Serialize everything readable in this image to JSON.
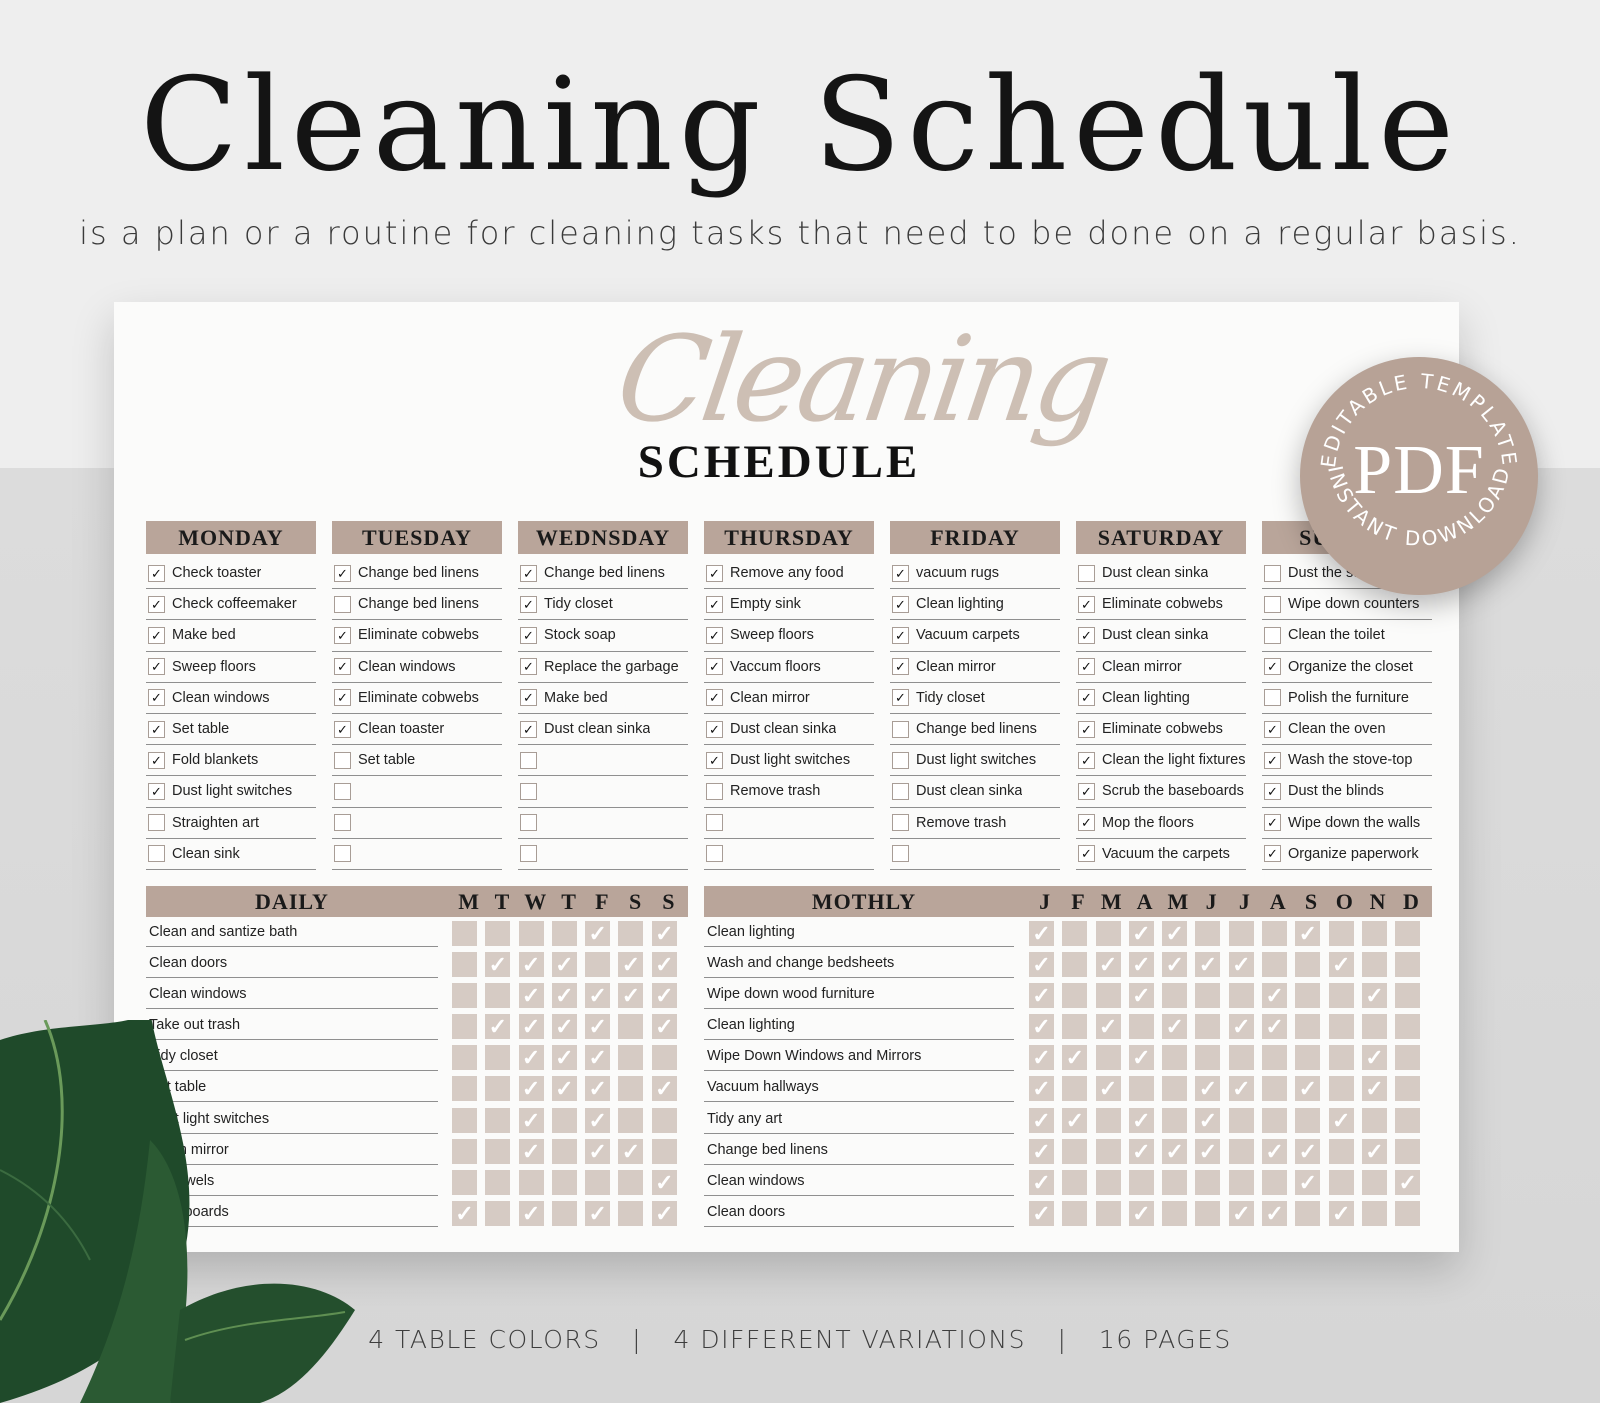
{
  "hero": {
    "title": "Cleaning Schedule",
    "subtitle": "is a plan or a routine for cleaning tasks that need to be done on a regular basis."
  },
  "sheet": {
    "script_title": "Cleaning",
    "title": "SCHEDULE",
    "accent_color": "#b9a59a",
    "cell_color": "#d6cbc4"
  },
  "weekdays": [
    {
      "name": "MONDAY",
      "tasks": [
        {
          "label": "Check toaster",
          "done": true
        },
        {
          "label": "Check coffeemaker",
          "done": true
        },
        {
          "label": "Make bed",
          "done": true
        },
        {
          "label": "Sweep floors",
          "done": true
        },
        {
          "label": "Clean windows",
          "done": true
        },
        {
          "label": "Set table",
          "done": true
        },
        {
          "label": "Fold blankets",
          "done": true
        },
        {
          "label": "Dust light switches",
          "done": true
        },
        {
          "label": "Straighten art",
          "done": false
        },
        {
          "label": "Clean sink",
          "done": false
        }
      ]
    },
    {
      "name": "TUESDAY",
      "tasks": [
        {
          "label": "Change bed linens",
          "done": true
        },
        {
          "label": "Change bed linens",
          "done": false
        },
        {
          "label": "Eliminate cobwebs",
          "done": true
        },
        {
          "label": "Clean windows",
          "done": true
        },
        {
          "label": "Eliminate cobwebs",
          "done": true
        },
        {
          "label": "Clean toaster",
          "done": true
        },
        {
          "label": "Set table",
          "done": false
        },
        {
          "label": "",
          "done": false
        },
        {
          "label": "",
          "done": false
        },
        {
          "label": "",
          "done": false
        }
      ]
    },
    {
      "name": "WEDNSDAY",
      "tasks": [
        {
          "label": "Change bed linens",
          "done": true
        },
        {
          "label": "Tidy closet",
          "done": true
        },
        {
          "label": "Stock soap",
          "done": true
        },
        {
          "label": "Replace the garbage",
          "done": true
        },
        {
          "label": "Make bed",
          "done": true
        },
        {
          "label": "Dust clean sinka",
          "done": true
        },
        {
          "label": "",
          "done": false
        },
        {
          "label": "",
          "done": false
        },
        {
          "label": "",
          "done": false
        },
        {
          "label": "",
          "done": false
        }
      ]
    },
    {
      "name": "THURSDAY",
      "tasks": [
        {
          "label": "Remove any food",
          "done": true
        },
        {
          "label": "Empty sink",
          "done": true
        },
        {
          "label": "Sweep floors",
          "done": true
        },
        {
          "label": "Vaccum floors",
          "done": true
        },
        {
          "label": "Clean mirror",
          "done": true
        },
        {
          "label": "Dust clean sinka",
          "done": true
        },
        {
          "label": "Dust light switches",
          "done": true
        },
        {
          "label": "Remove trash",
          "done": false
        },
        {
          "label": "",
          "done": false
        },
        {
          "label": "",
          "done": false
        }
      ]
    },
    {
      "name": "FRIDAY",
      "tasks": [
        {
          "label": "vacuum rugs",
          "done": true
        },
        {
          "label": "Clean lighting",
          "done": true
        },
        {
          "label": "Vacuum carpets",
          "done": true
        },
        {
          "label": "Clean mirror",
          "done": true
        },
        {
          "label": "Tidy closet",
          "done": true
        },
        {
          "label": "Change bed linens",
          "done": false
        },
        {
          "label": "Dust light switches",
          "done": false
        },
        {
          "label": "Dust clean sinka",
          "done": false
        },
        {
          "label": "Remove trash",
          "done": false
        },
        {
          "label": "",
          "done": false
        }
      ]
    },
    {
      "name": "SATURDAY",
      "tasks": [
        {
          "label": "Dust clean sinka",
          "done": false
        },
        {
          "label": "Eliminate cobwebs",
          "done": true
        },
        {
          "label": "Dust clean sinka",
          "done": true
        },
        {
          "label": "Clean mirror",
          "done": true
        },
        {
          "label": "Clean lighting",
          "done": true
        },
        {
          "label": "Eliminate cobwebs",
          "done": true
        },
        {
          "label": "Clean the light fixtures",
          "done": true
        },
        {
          "label": "Scrub the baseboards",
          "done": true
        },
        {
          "label": "Mop the floors",
          "done": true
        },
        {
          "label": "Vacuum the carpets",
          "done": true
        }
      ]
    },
    {
      "name": "SUNDAY",
      "tasks": [
        {
          "label": "Dust the su...",
          "done": false
        },
        {
          "label": "Wipe down counters",
          "done": false
        },
        {
          "label": "Clean the toilet",
          "done": false
        },
        {
          "label": "Organize the closet",
          "done": true
        },
        {
          "label": "Polish the furniture",
          "done": false
        },
        {
          "label": "Clean the oven",
          "done": true
        },
        {
          "label": "Wash the stove-top",
          "done": true
        },
        {
          "label": "Dust the blinds",
          "done": true
        },
        {
          "label": "Wipe down the walls",
          "done": true
        },
        {
          "label": "Organize paperwork",
          "done": true
        }
      ]
    }
  ],
  "daily": {
    "title": "DAILY",
    "columns": [
      "M",
      "T",
      "W",
      "T",
      "F",
      "S",
      "S"
    ],
    "rows": [
      {
        "task": "Clean and santize bath",
        "checks": [
          0,
          0,
          0,
          0,
          1,
          0,
          1
        ]
      },
      {
        "task": "Clean doors",
        "checks": [
          0,
          1,
          1,
          1,
          0,
          1,
          1
        ]
      },
      {
        "task": "Clean windows",
        "checks": [
          0,
          0,
          1,
          1,
          1,
          1,
          1
        ]
      },
      {
        "task": "Take out trash",
        "checks": [
          0,
          1,
          1,
          1,
          1,
          0,
          1
        ]
      },
      {
        "task": "Tidy closet",
        "checks": [
          0,
          0,
          1,
          1,
          1,
          0,
          0
        ]
      },
      {
        "task": "Set table",
        "checks": [
          0,
          0,
          1,
          1,
          1,
          0,
          1
        ]
      },
      {
        "task": "Dust light switches",
        "checks": [
          0,
          0,
          1,
          0,
          1,
          0,
          0
        ]
      },
      {
        "task": "Clean mirror",
        "checks": [
          0,
          0,
          1,
          0,
          1,
          1,
          0
        ]
      },
      {
        "task": "...e towels",
        "checks": [
          0,
          0,
          0,
          0,
          0,
          0,
          1
        ]
      },
      {
        "task": "...aseboards",
        "checks": [
          1,
          0,
          1,
          0,
          1,
          0,
          1
        ]
      }
    ]
  },
  "monthly": {
    "title": "MOTHLY",
    "columns": [
      "J",
      "F",
      "M",
      "A",
      "M",
      "J",
      "J",
      "A",
      "S",
      "O",
      "N",
      "D"
    ],
    "rows": [
      {
        "task": "Clean lighting",
        "checks": [
          1,
          0,
          0,
          1,
          1,
          0,
          0,
          0,
          1,
          0,
          0,
          0
        ]
      },
      {
        "task": "Wash and change bedsheets",
        "checks": [
          1,
          0,
          1,
          1,
          1,
          1,
          1,
          0,
          0,
          1,
          0,
          0
        ]
      },
      {
        "task": "Wipe down wood furniture",
        "checks": [
          1,
          0,
          0,
          1,
          0,
          0,
          0,
          1,
          0,
          0,
          1,
          0
        ]
      },
      {
        "task": "Clean lighting",
        "checks": [
          1,
          0,
          1,
          0,
          1,
          0,
          1,
          1,
          0,
          0,
          0,
          0
        ]
      },
      {
        "task": "Wipe Down Windows and Mirrors",
        "checks": [
          1,
          1,
          0,
          1,
          0,
          0,
          0,
          0,
          0,
          0,
          1,
          0
        ]
      },
      {
        "task": "Vacuum hallways",
        "checks": [
          1,
          0,
          1,
          0,
          0,
          1,
          1,
          0,
          1,
          0,
          1,
          0
        ]
      },
      {
        "task": "Tidy any art",
        "checks": [
          1,
          1,
          0,
          1,
          0,
          1,
          0,
          0,
          0,
          1,
          0,
          0
        ]
      },
      {
        "task": "Change bed linens",
        "checks": [
          1,
          0,
          0,
          1,
          1,
          1,
          0,
          1,
          1,
          0,
          1,
          0
        ]
      },
      {
        "task": "Clean windows",
        "checks": [
          1,
          0,
          0,
          0,
          0,
          0,
          0,
          0,
          1,
          0,
          0,
          1
        ]
      },
      {
        "task": "Clean doors",
        "checks": [
          1,
          0,
          0,
          1,
          0,
          0,
          1,
          1,
          0,
          1,
          0,
          0
        ]
      }
    ]
  },
  "badge": {
    "top_text": "EDITABLE TEMPLATE",
    "center_text": "PDF",
    "bottom_text": "INSTANT DOWNLOAD",
    "color": "#b7a296"
  },
  "footer": {
    "items": [
      "4 TABLE COLORS",
      "4 DIFFERENT VARIATIONS",
      "16 PAGES"
    ],
    "separator": "|"
  },
  "check_glyph": "✓"
}
